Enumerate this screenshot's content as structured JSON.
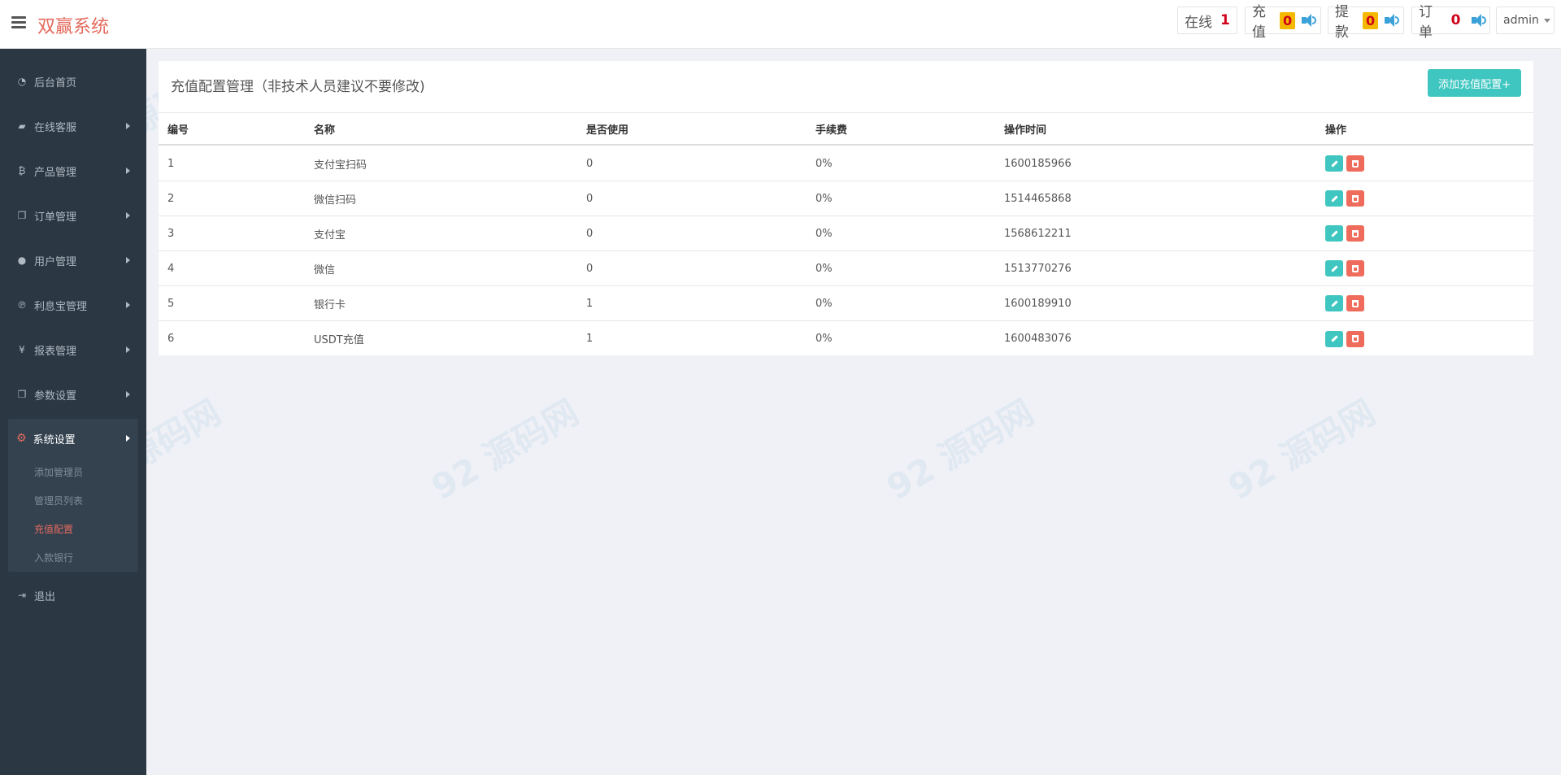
{
  "header": {
    "brand": "双赢系统",
    "online_label": "在线",
    "online_count": "1",
    "recharge_label": "充值",
    "recharge_count": "0",
    "withdraw_label": "提款",
    "withdraw_count": "0",
    "order_label": "订单",
    "order_count": "0",
    "user": "admin"
  },
  "sidebar": {
    "items": [
      {
        "label": "后台首页",
        "icon": "dashboard-icon"
      },
      {
        "label": "在线客服",
        "icon": "book-icon"
      },
      {
        "label": "产品管理",
        "icon": "bitcoin-icon"
      },
      {
        "label": "订单管理",
        "icon": "copy-icon"
      },
      {
        "label": "用户管理",
        "icon": "user-icon"
      },
      {
        "label": "利息宝管理",
        "icon": "pinterest-icon"
      },
      {
        "label": "报表管理",
        "icon": "yen-icon"
      },
      {
        "label": "参数设置",
        "icon": "copy-icon"
      }
    ],
    "active_group": {
      "label": "系统设置",
      "icon": "cogs-icon",
      "children": [
        "添加管理员",
        "管理员列表",
        "充值配置",
        "入款银行"
      ]
    },
    "logout": "退出"
  },
  "main": {
    "title": "充值配置管理（非技术人员建议不要修改)",
    "add_button": "添加充值配置+",
    "columns": [
      "编号",
      "名称",
      "是否使用",
      "手续费",
      "操作时间",
      "操作"
    ],
    "rows": [
      [
        "1",
        "支付宝扫码",
        "0",
        "0%",
        "1600185966"
      ],
      [
        "2",
        "微信扫码",
        "0",
        "0%",
        "1514465868"
      ],
      [
        "3",
        "支付宝",
        "0",
        "0%",
        "1568612211"
      ],
      [
        "4",
        "微信",
        "0",
        "0%",
        "1513770276"
      ],
      [
        "5",
        "银行卡",
        "1",
        "0%",
        "1600189910"
      ],
      [
        "6",
        "USDT充值",
        "1",
        "0%",
        "1600483076"
      ]
    ]
  },
  "colors": {
    "accent": "#3fc6c0",
    "danger": "#ef6b5b",
    "brand": "#e46a5c",
    "sidebar": "#2b3743"
  }
}
